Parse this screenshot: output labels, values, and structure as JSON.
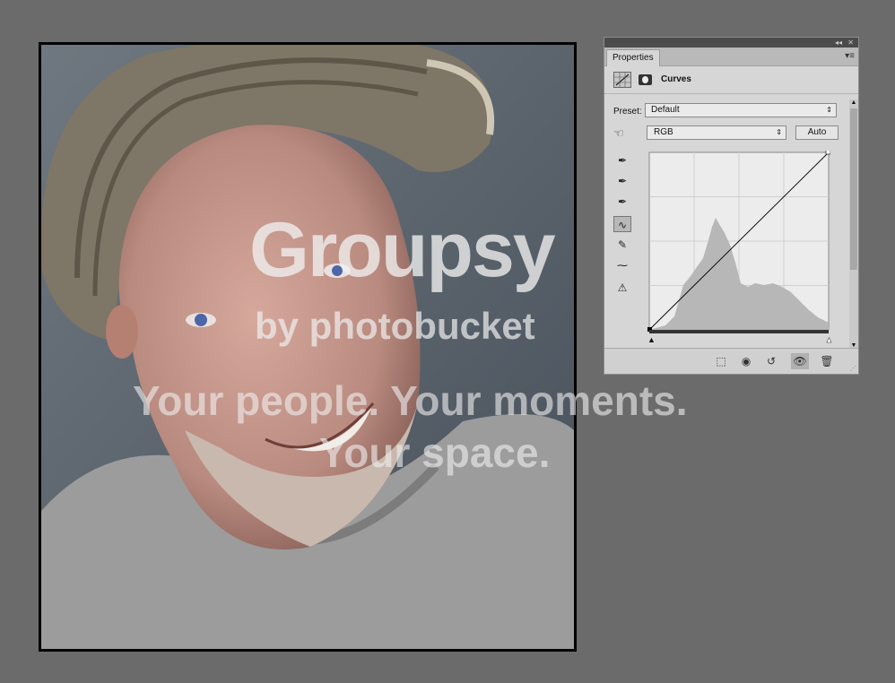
{
  "watermark": {
    "logo": "Groupsy",
    "byline": "by photobucket",
    "tagline_1": "Your people. Your moments.",
    "tagline_2": "Your space."
  },
  "panel": {
    "tab_label": "Properties",
    "adjustment_title": "Curves",
    "preset_label": "Preset:",
    "preset_value": "Default",
    "channel_value": "RGB",
    "auto_label": "Auto",
    "icons": [
      "curves-adjustment-icon",
      "mask-icon",
      "target-adjust-icon",
      "black-eyedropper-icon",
      "gray-eyedropper-icon",
      "white-eyedropper-icon",
      "curve-edit-icon",
      "pencil-icon",
      "smooth-icon",
      "clipping-warning-icon",
      "clip-to-layer-icon",
      "view-previous-icon",
      "reset-icon",
      "visibility-icon",
      "delete-icon"
    ]
  },
  "colors": {
    "app_bg": "#6b6b6b",
    "panel_bg": "#d6d6d6",
    "graph_bg": "#ececec"
  }
}
